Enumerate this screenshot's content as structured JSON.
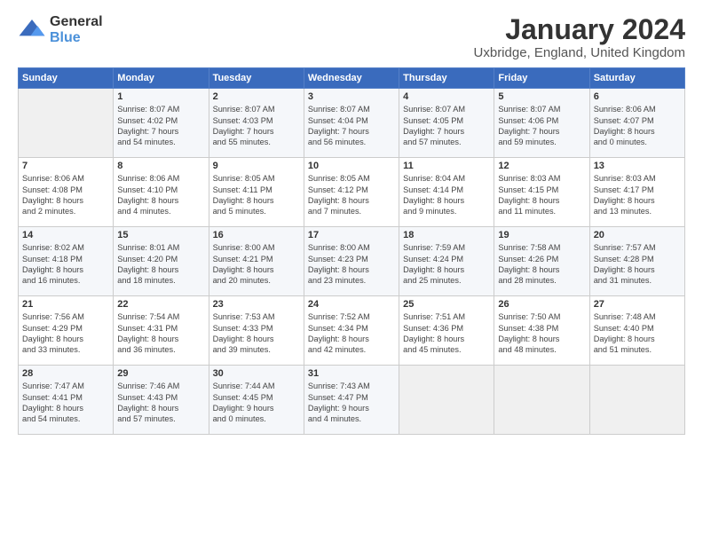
{
  "logo": {
    "general": "General",
    "blue": "Blue"
  },
  "title": "January 2024",
  "subtitle": "Uxbridge, England, United Kingdom",
  "headers": [
    "Sunday",
    "Monday",
    "Tuesday",
    "Wednesday",
    "Thursday",
    "Friday",
    "Saturday"
  ],
  "weeks": [
    [
      {
        "num": "",
        "info": ""
      },
      {
        "num": "1",
        "info": "Sunrise: 8:07 AM\nSunset: 4:02 PM\nDaylight: 7 hours\nand 54 minutes."
      },
      {
        "num": "2",
        "info": "Sunrise: 8:07 AM\nSunset: 4:03 PM\nDaylight: 7 hours\nand 55 minutes."
      },
      {
        "num": "3",
        "info": "Sunrise: 8:07 AM\nSunset: 4:04 PM\nDaylight: 7 hours\nand 56 minutes."
      },
      {
        "num": "4",
        "info": "Sunrise: 8:07 AM\nSunset: 4:05 PM\nDaylight: 7 hours\nand 57 minutes."
      },
      {
        "num": "5",
        "info": "Sunrise: 8:07 AM\nSunset: 4:06 PM\nDaylight: 7 hours\nand 59 minutes."
      },
      {
        "num": "6",
        "info": "Sunrise: 8:06 AM\nSunset: 4:07 PM\nDaylight: 8 hours\nand 0 minutes."
      }
    ],
    [
      {
        "num": "7",
        "info": "Sunrise: 8:06 AM\nSunset: 4:08 PM\nDaylight: 8 hours\nand 2 minutes."
      },
      {
        "num": "8",
        "info": "Sunrise: 8:06 AM\nSunset: 4:10 PM\nDaylight: 8 hours\nand 4 minutes."
      },
      {
        "num": "9",
        "info": "Sunrise: 8:05 AM\nSunset: 4:11 PM\nDaylight: 8 hours\nand 5 minutes."
      },
      {
        "num": "10",
        "info": "Sunrise: 8:05 AM\nSunset: 4:12 PM\nDaylight: 8 hours\nand 7 minutes."
      },
      {
        "num": "11",
        "info": "Sunrise: 8:04 AM\nSunset: 4:14 PM\nDaylight: 8 hours\nand 9 minutes."
      },
      {
        "num": "12",
        "info": "Sunrise: 8:03 AM\nSunset: 4:15 PM\nDaylight: 8 hours\nand 11 minutes."
      },
      {
        "num": "13",
        "info": "Sunrise: 8:03 AM\nSunset: 4:17 PM\nDaylight: 8 hours\nand 13 minutes."
      }
    ],
    [
      {
        "num": "14",
        "info": "Sunrise: 8:02 AM\nSunset: 4:18 PM\nDaylight: 8 hours\nand 16 minutes."
      },
      {
        "num": "15",
        "info": "Sunrise: 8:01 AM\nSunset: 4:20 PM\nDaylight: 8 hours\nand 18 minutes."
      },
      {
        "num": "16",
        "info": "Sunrise: 8:00 AM\nSunset: 4:21 PM\nDaylight: 8 hours\nand 20 minutes."
      },
      {
        "num": "17",
        "info": "Sunrise: 8:00 AM\nSunset: 4:23 PM\nDaylight: 8 hours\nand 23 minutes."
      },
      {
        "num": "18",
        "info": "Sunrise: 7:59 AM\nSunset: 4:24 PM\nDaylight: 8 hours\nand 25 minutes."
      },
      {
        "num": "19",
        "info": "Sunrise: 7:58 AM\nSunset: 4:26 PM\nDaylight: 8 hours\nand 28 minutes."
      },
      {
        "num": "20",
        "info": "Sunrise: 7:57 AM\nSunset: 4:28 PM\nDaylight: 8 hours\nand 31 minutes."
      }
    ],
    [
      {
        "num": "21",
        "info": "Sunrise: 7:56 AM\nSunset: 4:29 PM\nDaylight: 8 hours\nand 33 minutes."
      },
      {
        "num": "22",
        "info": "Sunrise: 7:54 AM\nSunset: 4:31 PM\nDaylight: 8 hours\nand 36 minutes."
      },
      {
        "num": "23",
        "info": "Sunrise: 7:53 AM\nSunset: 4:33 PM\nDaylight: 8 hours\nand 39 minutes."
      },
      {
        "num": "24",
        "info": "Sunrise: 7:52 AM\nSunset: 4:34 PM\nDaylight: 8 hours\nand 42 minutes."
      },
      {
        "num": "25",
        "info": "Sunrise: 7:51 AM\nSunset: 4:36 PM\nDaylight: 8 hours\nand 45 minutes."
      },
      {
        "num": "26",
        "info": "Sunrise: 7:50 AM\nSunset: 4:38 PM\nDaylight: 8 hours\nand 48 minutes."
      },
      {
        "num": "27",
        "info": "Sunrise: 7:48 AM\nSunset: 4:40 PM\nDaylight: 8 hours\nand 51 minutes."
      }
    ],
    [
      {
        "num": "28",
        "info": "Sunrise: 7:47 AM\nSunset: 4:41 PM\nDaylight: 8 hours\nand 54 minutes."
      },
      {
        "num": "29",
        "info": "Sunrise: 7:46 AM\nSunset: 4:43 PM\nDaylight: 8 hours\nand 57 minutes."
      },
      {
        "num": "30",
        "info": "Sunrise: 7:44 AM\nSunset: 4:45 PM\nDaylight: 9 hours\nand 0 minutes."
      },
      {
        "num": "31",
        "info": "Sunrise: 7:43 AM\nSunset: 4:47 PM\nDaylight: 9 hours\nand 4 minutes."
      },
      {
        "num": "",
        "info": ""
      },
      {
        "num": "",
        "info": ""
      },
      {
        "num": "",
        "info": ""
      }
    ]
  ]
}
